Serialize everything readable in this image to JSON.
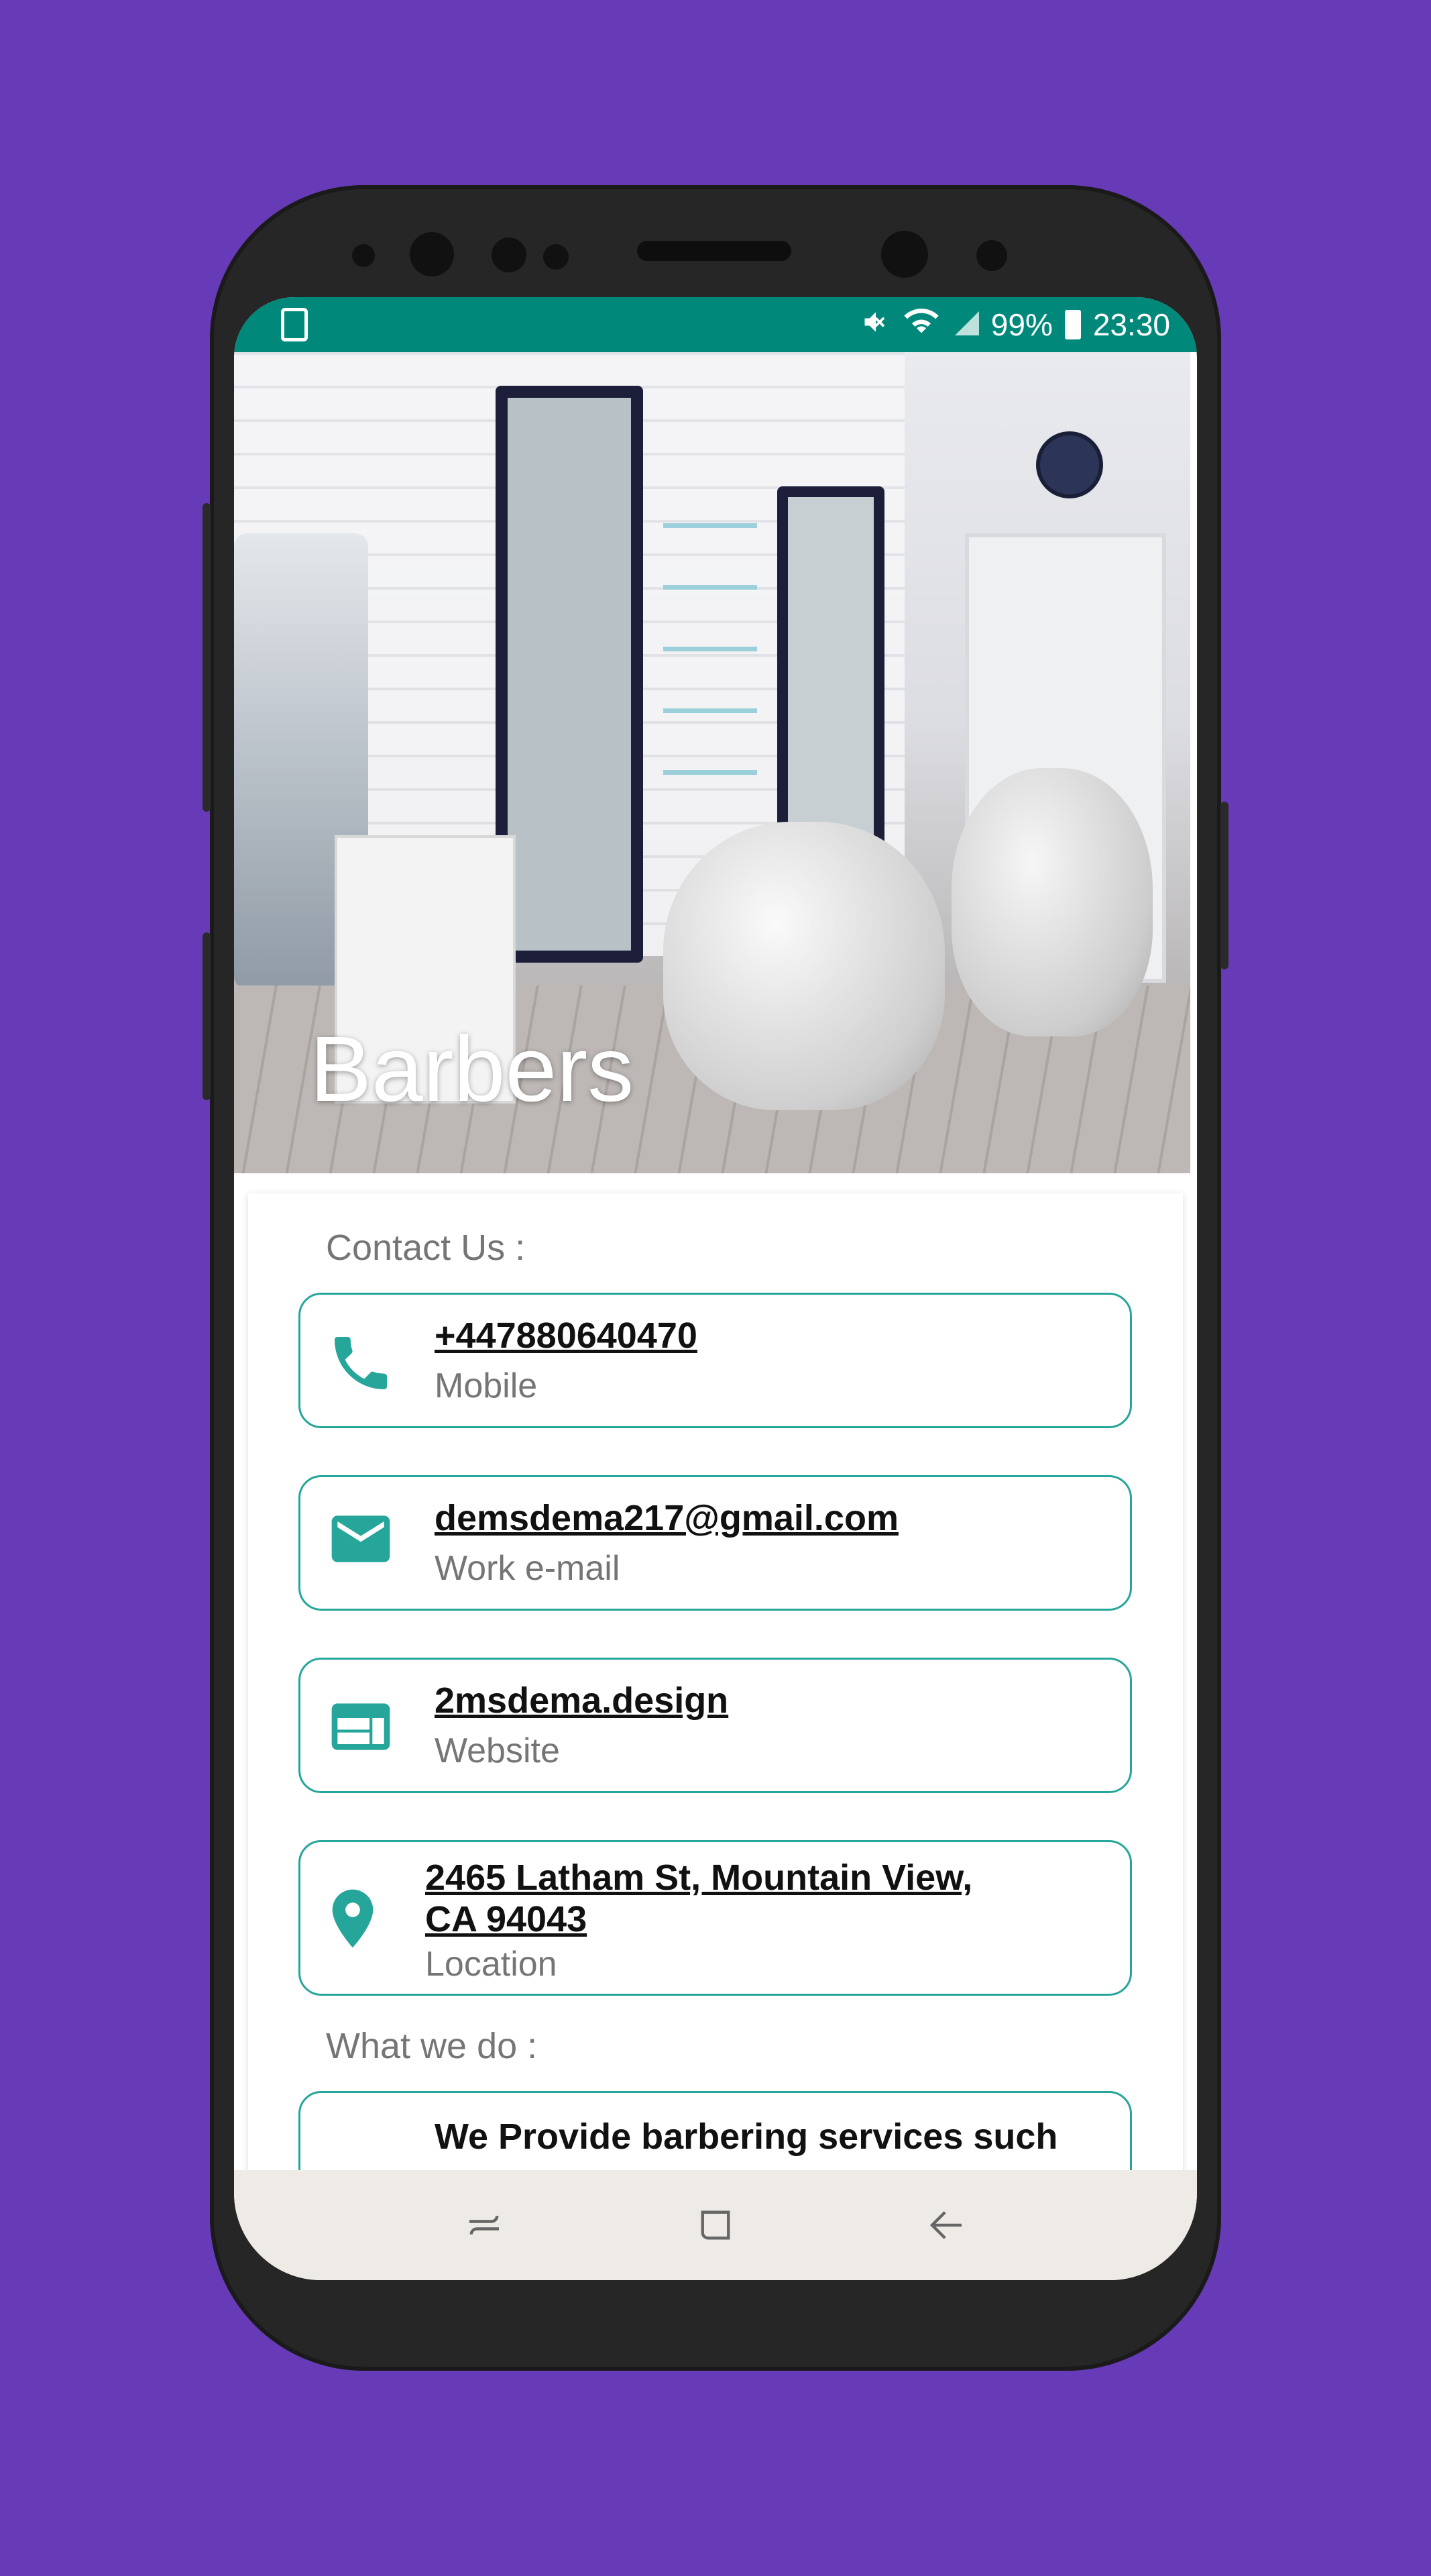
{
  "status_bar": {
    "battery_percent": "99%",
    "time": "23:30"
  },
  "hero": {
    "title": "Barbers"
  },
  "contact": {
    "section_label": "Contact Us :",
    "items": [
      {
        "value": "+447880640470",
        "label": "Mobile",
        "icon": "phone-icon"
      },
      {
        "value": "demsdema217@gmail.com",
        "label": "Work e-mail",
        "icon": "mail-icon"
      },
      {
        "value": "2msdema.design",
        "label": "Website",
        "icon": "web-icon"
      },
      {
        "value": "2465 Latham St, Mountain View,\nCA 94043",
        "label": "Location",
        "icon": "location-icon"
      }
    ]
  },
  "about": {
    "section_label": "What we do :",
    "text": "We Provide barbering services such"
  },
  "colors": {
    "background": "#673ab7",
    "status_bar": "#00897b",
    "accent": "#26a69a"
  }
}
